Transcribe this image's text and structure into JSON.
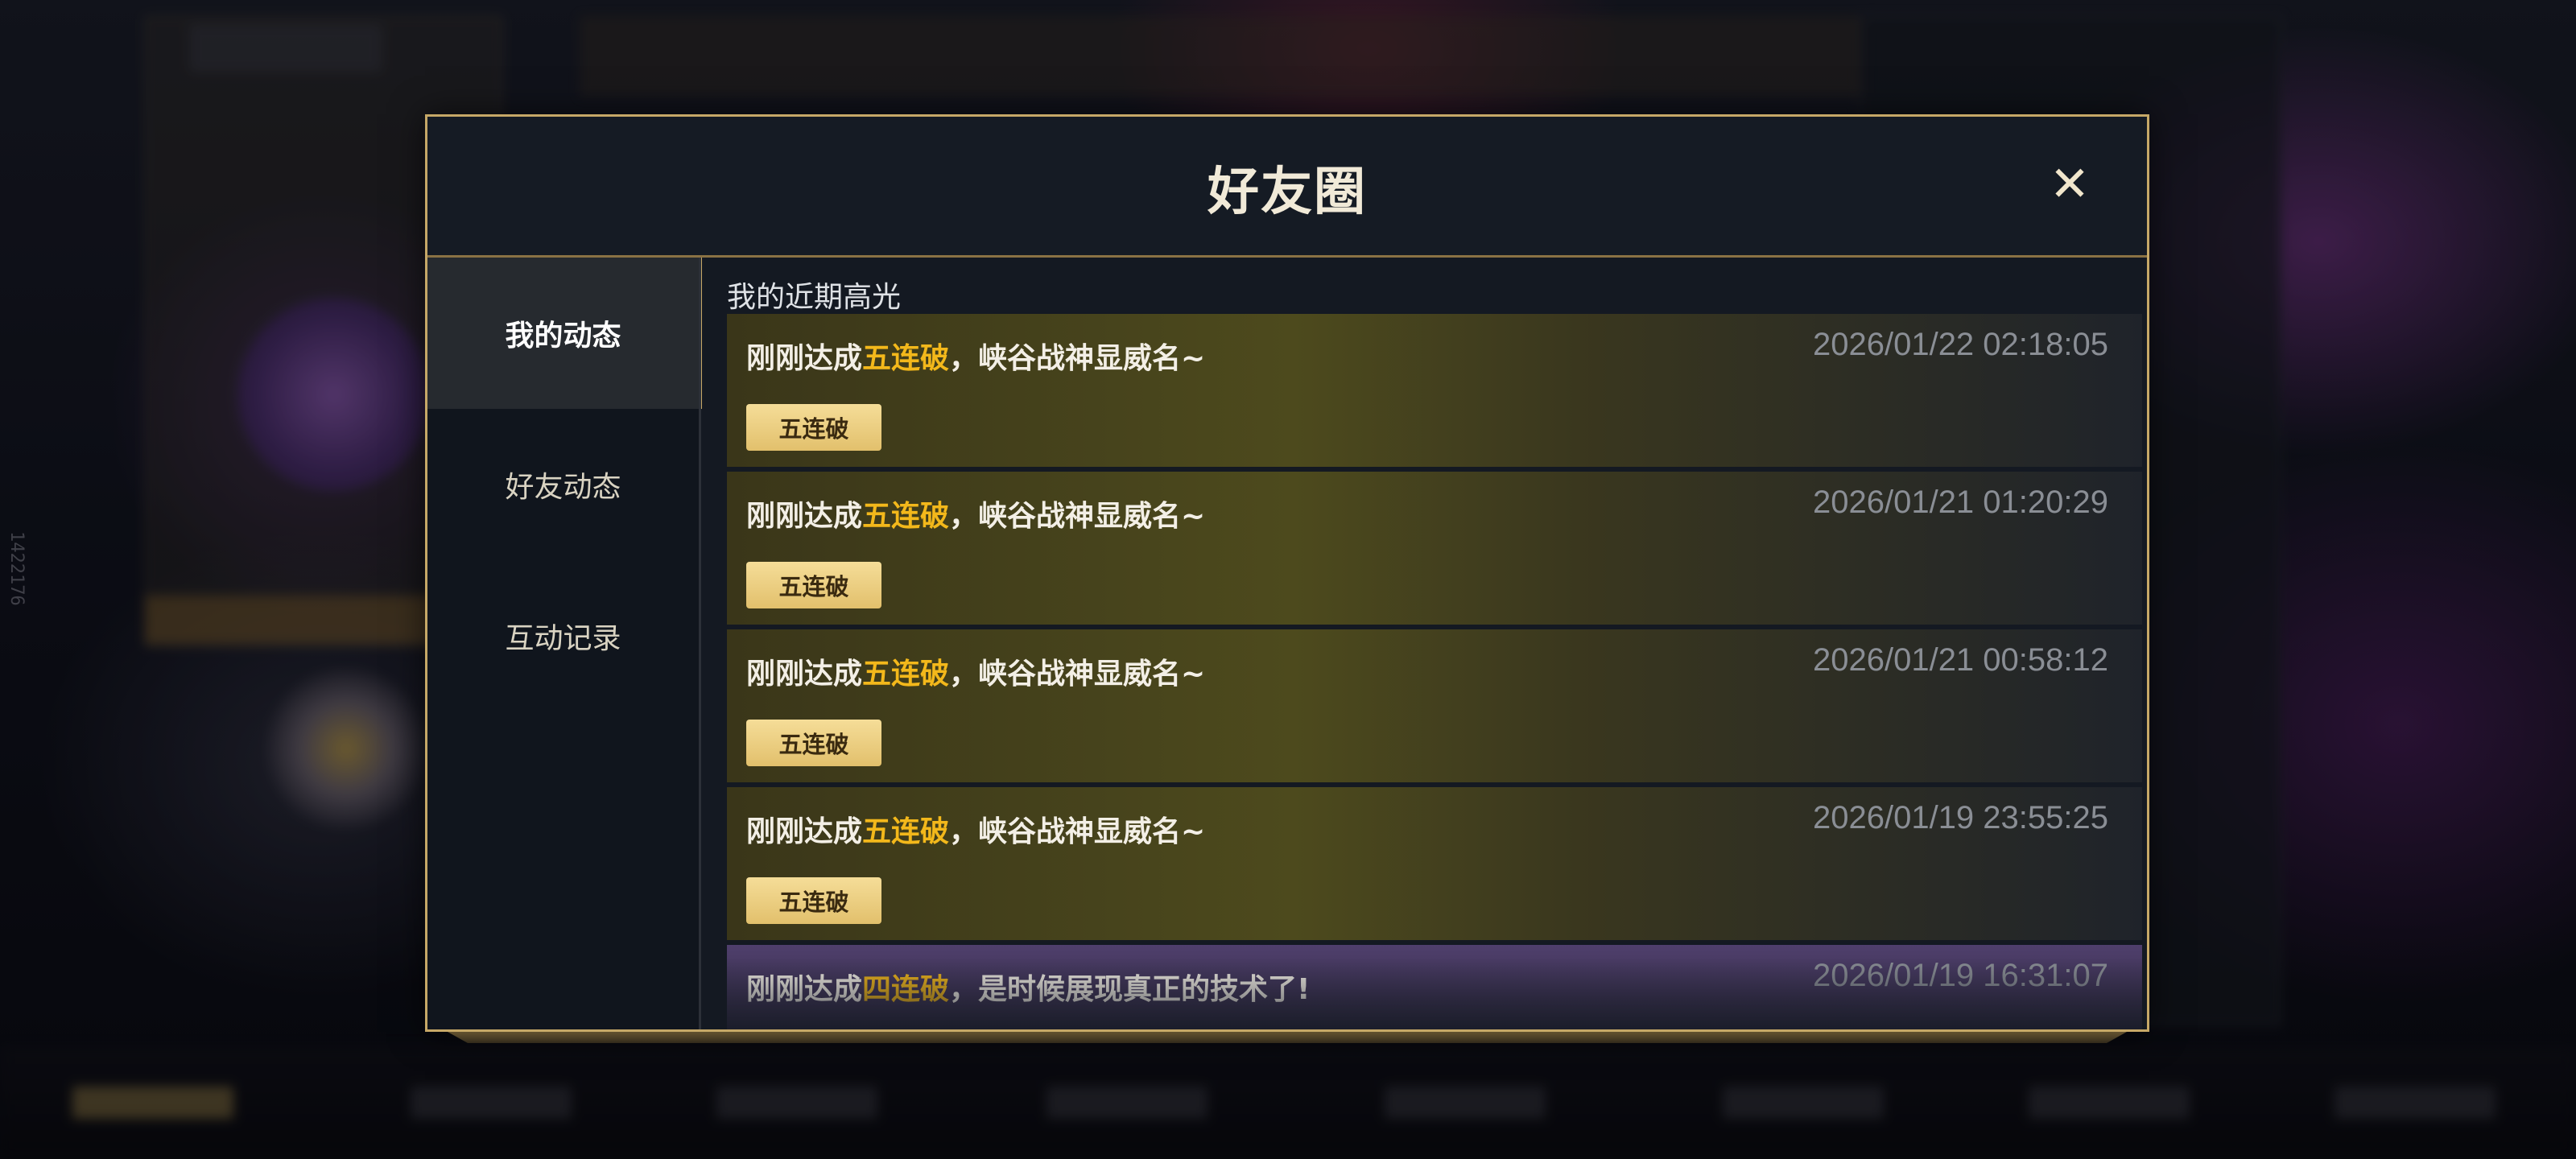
{
  "dialog": {
    "title": "好友圈",
    "close_icon": "close-icon"
  },
  "sidebar": {
    "items": [
      {
        "label": "我的动态",
        "active": true
      },
      {
        "label": "好友动态",
        "active": false
      },
      {
        "label": "互动记录",
        "active": false
      }
    ]
  },
  "content": {
    "section_title": "我的近期高光",
    "posts": [
      {
        "prefix": "刚刚达成",
        "highlight": "五连破",
        "suffix": "，峡谷战神显威名~",
        "time": "2026/01/22 02:18:05",
        "badge": "五连破",
        "style": "gold"
      },
      {
        "prefix": "刚刚达成",
        "highlight": "五连破",
        "suffix": "，峡谷战神显威名~",
        "time": "2026/01/21 01:20:29",
        "badge": "五连破",
        "style": "gold"
      },
      {
        "prefix": "刚刚达成",
        "highlight": "五连破",
        "suffix": "，峡谷战神显威名~",
        "time": "2026/01/21 00:58:12",
        "badge": "五连破",
        "style": "gold"
      },
      {
        "prefix": "刚刚达成",
        "highlight": "五连破",
        "suffix": "，峡谷战神显威名~",
        "time": "2026/01/19 23:55:25",
        "badge": "五连破",
        "style": "gold"
      },
      {
        "prefix": "刚刚达成",
        "highlight": "四连破",
        "suffix": "，是时候展现真正的技术了!",
        "time": "2026/01/19 16:31:07",
        "badge": "",
        "style": "purple"
      }
    ]
  },
  "background": {
    "side_id": "1422176"
  },
  "colors": {
    "accent_gold": "#c6a867",
    "highlight": "#f3b81b",
    "panel": "#141922"
  }
}
